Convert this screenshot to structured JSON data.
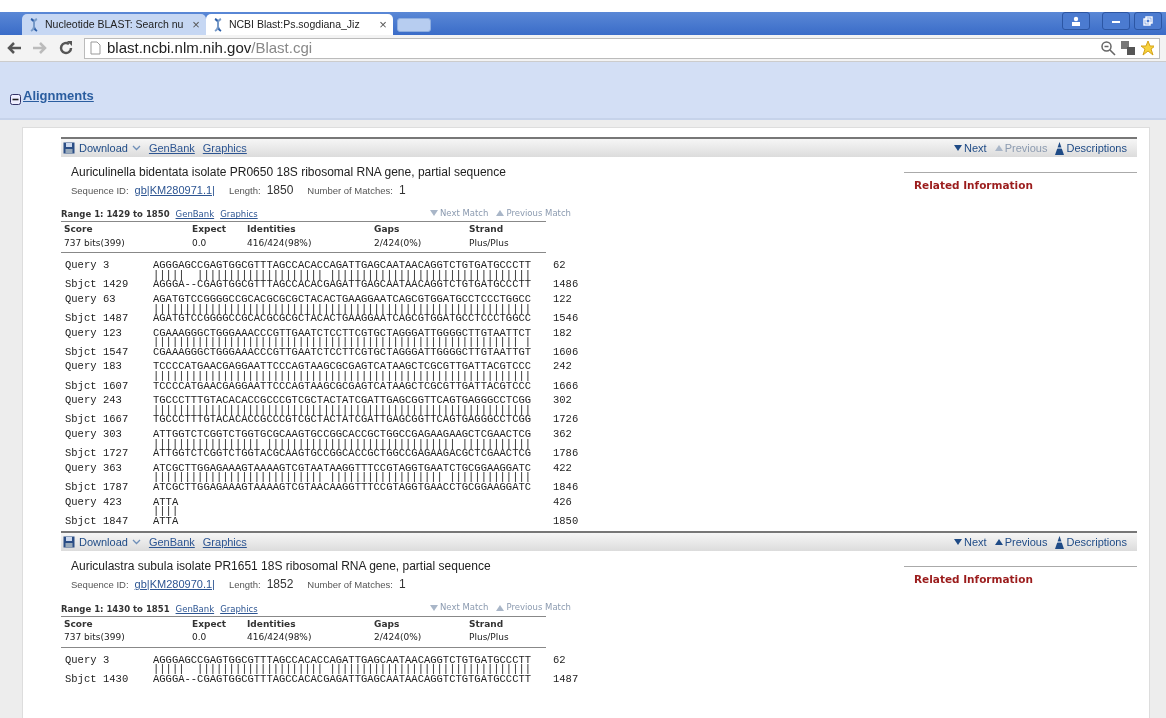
{
  "browser": {
    "tabs": [
      {
        "title": "Nucleotide BLAST: Search nu",
        "close": "×",
        "selected": false
      },
      {
        "title": "NCBI Blast:Ps.sogdiana_Jiz",
        "close": "×",
        "selected": true
      }
    ],
    "url_host": "blast.ncbi.nlm.nih.gov",
    "url_path": "/Blast.cgi"
  },
  "section": {
    "title": "Alignments",
    "expanded": true
  },
  "hits": [
    {
      "toolbar": {
        "download": "Download",
        "links": [
          "GenBank",
          "Graphics"
        ],
        "nav": [
          {
            "kind": "next",
            "label": "Next",
            "disabled": false
          },
          {
            "kind": "previous",
            "label": "Previous",
            "disabled": true
          },
          {
            "kind": "descriptions",
            "label": "Descriptions",
            "disabled": false
          }
        ]
      },
      "title": "Auriculinella bidentata isolate PR0650 18S ribosomal RNA gene, partial sequence",
      "seq_id_label": "Sequence ID:",
      "seq_id": "gb|KM280971.1|",
      "length_label": "Length:",
      "length": "1850",
      "matches_label": "Number of Matches:",
      "matches": "1",
      "related": "Related Information",
      "range": {
        "label": "Range 1: 1429 to 1850",
        "links": [
          "GenBank",
          "Graphics"
        ],
        "nav": [
          {
            "kind": "next",
            "label": "Next Match",
            "disabled": true
          },
          {
            "kind": "previous",
            "label": "Previous Match",
            "disabled": true
          }
        ]
      },
      "stats": [
        {
          "heading": "Score",
          "value": "737 bits(399)"
        },
        {
          "heading": "Expect",
          "value": "0.0"
        },
        {
          "heading": "Identities",
          "value": "416/424(98%)"
        },
        {
          "heading": "Gaps",
          "value": "2/424(0%)"
        },
        {
          "heading": "Strand",
          "value": "Plus/Plus"
        }
      ],
      "alignment": [
        {
          "query_label": "Query",
          "query_start": "3",
          "query_seq": "AGGGAGCCGAGTGGCGTTTAGCCACACCAGATTGAGCAATAACAGGTCTGTGATGCCCTT",
          "query_end": "62",
          "midline": "|||||  |||||||||||||||||||| ||||||||||||||||||||||||||||||||",
          "sbjct_label": "Sbjct",
          "sbjct_start": "1429",
          "sbjct_seq": "AGGGA--CGAGTGGCGTTTAGCCACACGAGATTGAGCAATAACAGGTCTGTGATGCCCTT",
          "sbjct_end": "1486"
        },
        {
          "query_label": "Query",
          "query_start": "63",
          "query_seq": "AGATGTCCGGGGCCGCACGCGCGCTACACTGAAGGAATCAGCGTGGATGCCTCCCTGGCC",
          "query_end": "122",
          "midline": "||||||||||||||||||||||||||||||||||||||||||||||||||||||||||||",
          "sbjct_label": "Sbjct",
          "sbjct_start": "1487",
          "sbjct_seq": "AGATGTCCGGGGCCGCACGCGCGCTACACTGAAGGAATCAGCGTGGATGCCTCCCTGGCC",
          "sbjct_end": "1546"
        },
        {
          "query_label": "Query",
          "query_start": "123",
          "query_seq": "CGAAAGGGCTGGGAAACCCGTTGAATCTCCTTCGTGCTAGGGATTGGGGCTTGTAATTCT",
          "query_end": "182",
          "midline": "|||||||||||||||||||||||||||||||||||||||||||||||||||||||||| |",
          "sbjct_label": "Sbjct",
          "sbjct_start": "1547",
          "sbjct_seq": "CGAAAGGGCTGGGAAACCCGTTGAATCTCCTTCGTGCTAGGGATTGGGGCTTGTAATTGT",
          "sbjct_end": "1606"
        },
        {
          "query_label": "Query",
          "query_start": "183",
          "query_seq": "TCCCCATGAACGAGGAATTCCCAGTAAGCGCGAGTCATAAGCTCGCGTTGATTACGTCCC",
          "query_end": "242",
          "midline": "||||||||||||||||||||||||||||||||||||||||||||||||||||||||||||",
          "sbjct_label": "Sbjct",
          "sbjct_start": "1607",
          "sbjct_seq": "TCCCCATGAACGAGGAATTCCCAGTAAGCGCGAGTCATAAGCTCGCGTTGATTACGTCCC",
          "sbjct_end": "1666"
        },
        {
          "query_label": "Query",
          "query_start": "243",
          "query_seq": "TGCCCTTTGTACACACCGCCCGTCGCTACTATCGATTGAGCGGTTCAGTGAGGGCCTCGG",
          "query_end": "302",
          "midline": "||||||||||||||||||||||||||||||||||||||||||||||||||||||||||||",
          "sbjct_label": "Sbjct",
          "sbjct_start": "1667",
          "sbjct_seq": "TGCCCTTTGTACACACCGCCCGTCGCTACTATCGATTGAGCGGTTCAGTGAGGGCCTCGG",
          "sbjct_end": "1726"
        },
        {
          "query_label": "Query",
          "query_start": "303",
          "query_seq": "ATTGGTCTCGGTCTGGTGCGCAAGTGCCGGCACCGCTGGCCGAGAAGAAGCTCGAACTCG",
          "query_end": "362",
          "midline": "||||||||||||||||| |||||||||||||||||||||||||||||| |||||||||||",
          "sbjct_label": "Sbjct",
          "sbjct_start": "1727",
          "sbjct_seq": "ATTGGTCTCGGTCTGGTACGCAAGTGCCGGCACCGCTGGCCGAGAAGACGCTCGAACTCG",
          "sbjct_end": "1786"
        },
        {
          "query_label": "Query",
          "query_start": "363",
          "query_seq": "ATCGCTTGGAGAAAGTAAAAGTCGTAATAAGGTTTCCGTAGGTGAATCTGCGGAAGGATC",
          "query_end": "422",
          "midline": "||||||||||||||||||||||||||| |||||||||||||||||| |||||||||||||",
          "sbjct_label": "Sbjct",
          "sbjct_start": "1787",
          "sbjct_seq": "ATCGCTTGGAGAAAGTAAAAGTCGTAACAAGGTTTCCGTAGGTGAACCTGCGGAAGGATC",
          "sbjct_end": "1846"
        },
        {
          "query_label": "Query",
          "query_start": "423",
          "query_seq": "ATTA",
          "query_end": "426",
          "midline": "||||",
          "sbjct_label": "Sbjct",
          "sbjct_start": "1847",
          "sbjct_seq": "ATTA",
          "sbjct_end": "1850"
        }
      ]
    },
    {
      "toolbar": {
        "download": "Download",
        "links": [
          "GenBank",
          "Graphics"
        ],
        "nav": [
          {
            "kind": "next",
            "label": "Next",
            "disabled": false
          },
          {
            "kind": "previous",
            "label": "Previous",
            "disabled": false
          },
          {
            "kind": "descriptions",
            "label": "Descriptions",
            "disabled": false
          }
        ]
      },
      "title": "Auriculastra subula isolate PR1651 18S ribosomal RNA gene, partial sequence",
      "seq_id_label": "Sequence ID:",
      "seq_id": "gb|KM280970.1|",
      "length_label": "Length:",
      "length": "1852",
      "matches_label": "Number of Matches:",
      "matches": "1",
      "related": "Related Information",
      "range": {
        "label": "Range 1: 1430 to 1851",
        "links": [
          "GenBank",
          "Graphics"
        ],
        "nav": [
          {
            "kind": "next",
            "label": "Next Match",
            "disabled": true
          },
          {
            "kind": "previous",
            "label": "Previous Match",
            "disabled": true
          }
        ]
      },
      "stats": [
        {
          "heading": "Score",
          "value": "737 bits(399)"
        },
        {
          "heading": "Expect",
          "value": "0.0"
        },
        {
          "heading": "Identities",
          "value": "416/424(98%)"
        },
        {
          "heading": "Gaps",
          "value": "2/424(0%)"
        },
        {
          "heading": "Strand",
          "value": "Plus/Plus"
        }
      ],
      "alignment": [
        {
          "query_label": "Query",
          "query_start": "3",
          "query_seq": "AGGGAGCCGAGTGGCGTTTAGCCACACCAGATTGAGCAATAACAGGTCTGTGATGCCCTT",
          "query_end": "62",
          "midline": "|||||  |||||||||||||||||||| ||||||||||||||||||||||||||||||||",
          "sbjct_label": "Sbjct",
          "sbjct_start": "1430",
          "sbjct_seq": "AGGGA--CGAGTGGCGTTTAGCCACACGAGATTGAGCAATAACAGGTCTGTGATGCCCTT",
          "sbjct_end": "1487"
        }
      ]
    }
  ]
}
